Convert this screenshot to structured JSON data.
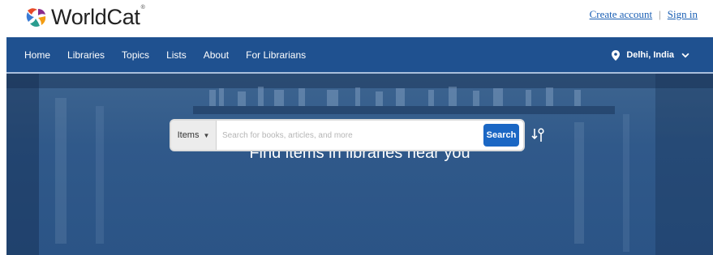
{
  "header": {
    "brand": "WorldCat",
    "brand_mark": "®",
    "create_account": "Create account",
    "separator": "|",
    "sign_in": "Sign in"
  },
  "nav": {
    "items": [
      {
        "label": "Home"
      },
      {
        "label": "Libraries"
      },
      {
        "label": "Topics"
      },
      {
        "label": "Lists"
      },
      {
        "label": "About"
      },
      {
        "label": "For Librarians"
      }
    ],
    "location": "Delhi, India"
  },
  "hero": {
    "title": "Find items in libraries near you"
  },
  "search": {
    "type_label": "Items",
    "placeholder": "Search for books, articles, and more",
    "value": "",
    "button_label": "Search"
  },
  "colors": {
    "nav_bg": "#1f5190",
    "link": "#1a5fb4",
    "search_button": "#1b67c4"
  },
  "icons": [
    "worldcat-logo-icon",
    "location-pin-icon",
    "chevron-down-icon",
    "caret-down-icon",
    "advanced-search-icon"
  ]
}
